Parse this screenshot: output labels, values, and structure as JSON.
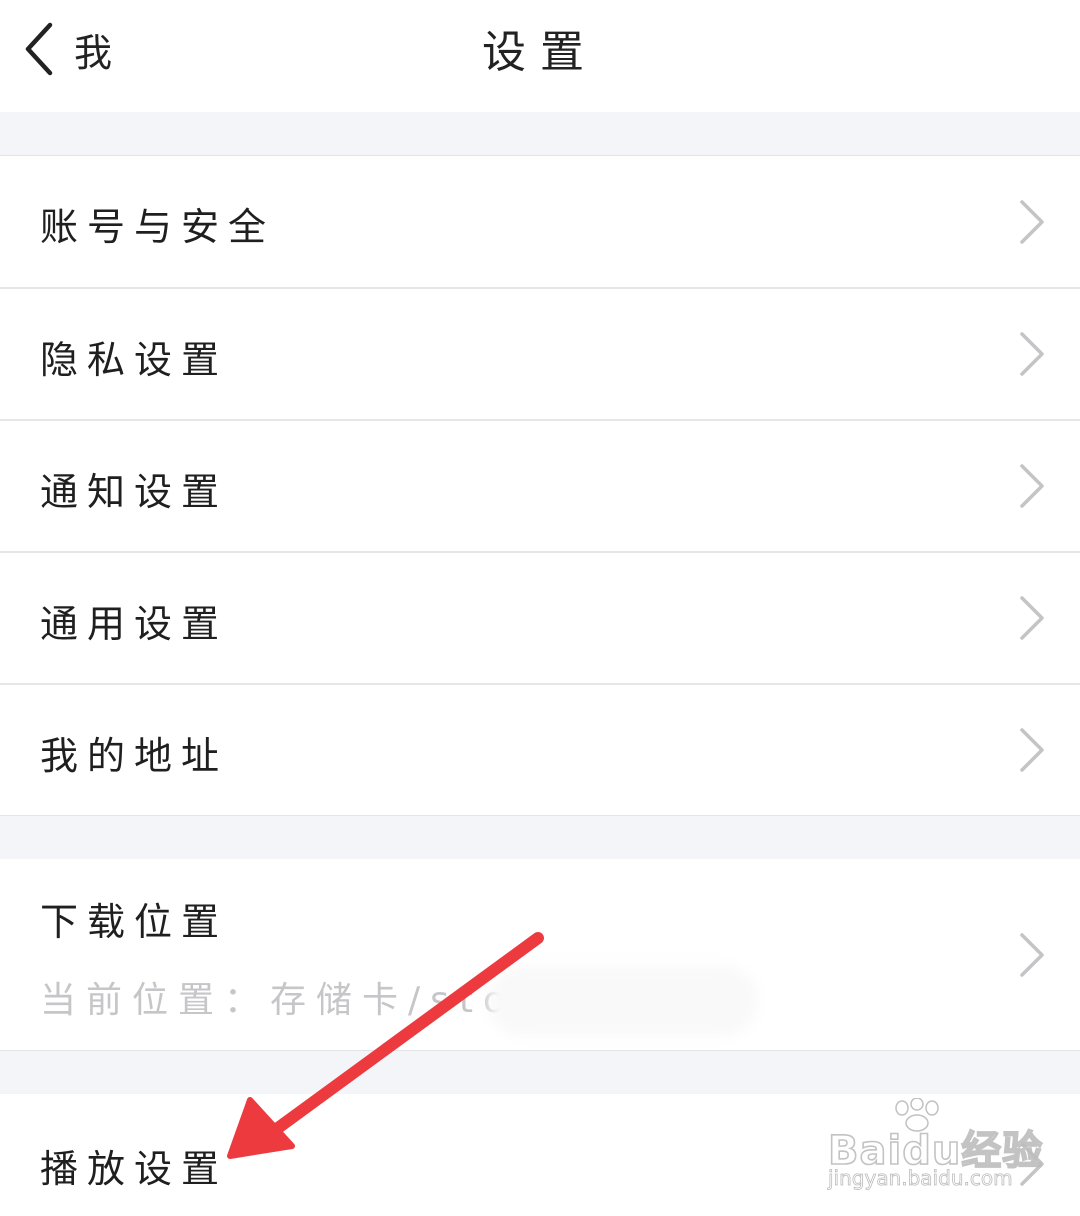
{
  "navbar": {
    "back_label": "我",
    "title": "设置"
  },
  "settings_groups": [
    {
      "items": [
        {
          "label": "账号与安全"
        },
        {
          "label": "隐私设置"
        },
        {
          "label": "通知设置"
        },
        {
          "label": "通用设置"
        },
        {
          "label": "我的地址"
        }
      ]
    },
    {
      "items": [
        {
          "label": "下载位置",
          "sublabel": "当前位置：存储卡/stord"
        }
      ]
    },
    {
      "items": [
        {
          "label": "播放设置"
        }
      ]
    }
  ],
  "watermark": {
    "brand": "Baidu经验",
    "url": "jingyan.baidu.com"
  },
  "colors": {
    "separator": "#f4f5f9",
    "chevron": "#c4c4c7",
    "annotation_arrow": "#ec3a3f",
    "sublabel": "#c6c6c9"
  },
  "icons": {
    "back": "chevron-left-icon",
    "row_chevron": "chevron-right-icon",
    "annotation": "arrow-annotation-icon",
    "watermark_paw": "paw-icon"
  }
}
